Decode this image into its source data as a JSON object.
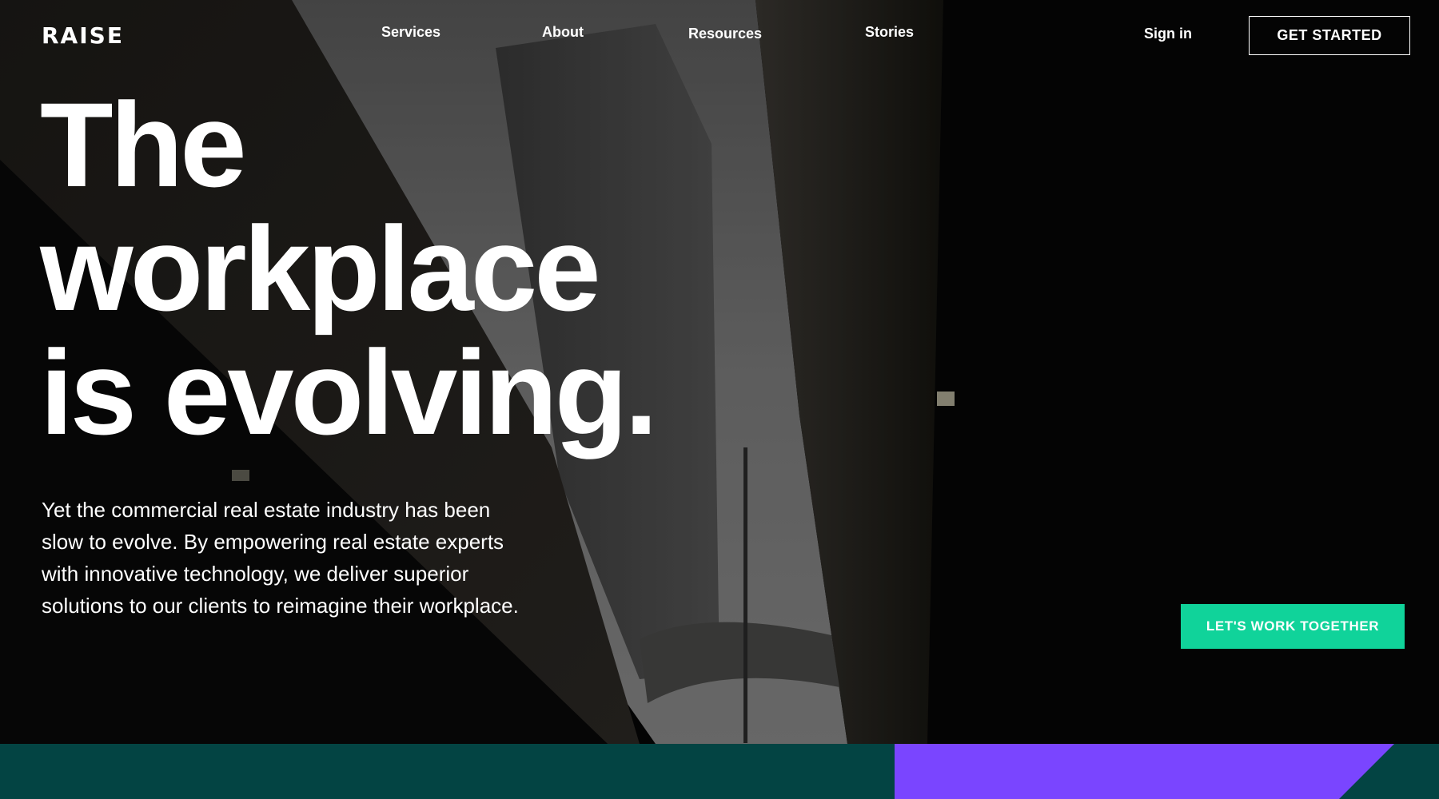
{
  "brand": {
    "logo_text": "RAISE"
  },
  "nav": {
    "links": [
      {
        "label": "Services"
      },
      {
        "label": "About"
      },
      {
        "label": "Resources"
      },
      {
        "label": "Stories"
      }
    ],
    "sign_in": "Sign in",
    "get_started": "GET STARTED"
  },
  "hero": {
    "headline_lines": [
      "The",
      "workplace",
      "is evolving."
    ],
    "intro": "Yet the commercial real estate industry has been slow to evolve. By empowering real estate experts with innovative technology, we deliver superior solutions to our clients to reimagine their workplace.",
    "cta": "LET'S WORK TOGETHER"
  },
  "colors": {
    "accent_green": "#10d39a",
    "band_teal": "#034443",
    "band_purple": "#7a45ff"
  }
}
